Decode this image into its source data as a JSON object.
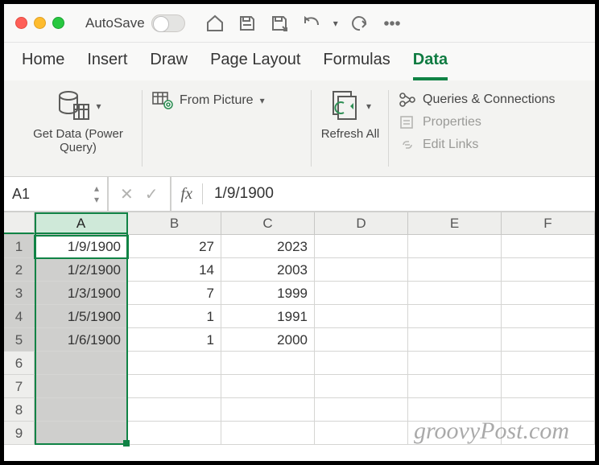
{
  "titlebar": {
    "autosave_label": "AutoSave"
  },
  "tabs": {
    "home": "Home",
    "insert": "Insert",
    "draw": "Draw",
    "page_layout": "Page Layout",
    "formulas": "Formulas",
    "data": "Data"
  },
  "ribbon": {
    "get_data": "Get Data (Power Query)",
    "from_picture": "From Picture",
    "refresh_all": "Refresh All",
    "queries_conn": "Queries & Connections",
    "properties": "Properties",
    "edit_links": "Edit Links"
  },
  "formula_bar": {
    "name_box": "A1",
    "fx": "fx",
    "value": "1/9/1900"
  },
  "cols": [
    "A",
    "B",
    "C",
    "D",
    "E",
    "F"
  ],
  "rows": [
    {
      "n": "1",
      "a": "1/9/1900",
      "b": "27",
      "c": "2023"
    },
    {
      "n": "2",
      "a": "1/2/1900",
      "b": "14",
      "c": "2003"
    },
    {
      "n": "3",
      "a": "1/3/1900",
      "b": "7",
      "c": "1999"
    },
    {
      "n": "4",
      "a": "1/5/1900",
      "b": "1",
      "c": "1991"
    },
    {
      "n": "5",
      "a": "1/6/1900",
      "b": "1",
      "c": "2000"
    },
    {
      "n": "6",
      "a": "",
      "b": "",
      "c": ""
    },
    {
      "n": "7",
      "a": "",
      "b": "",
      "c": ""
    },
    {
      "n": "8",
      "a": "",
      "b": "",
      "c": ""
    },
    {
      "n": "9",
      "a": "",
      "b": "",
      "c": ""
    }
  ],
  "watermark": "groovyPost.com"
}
